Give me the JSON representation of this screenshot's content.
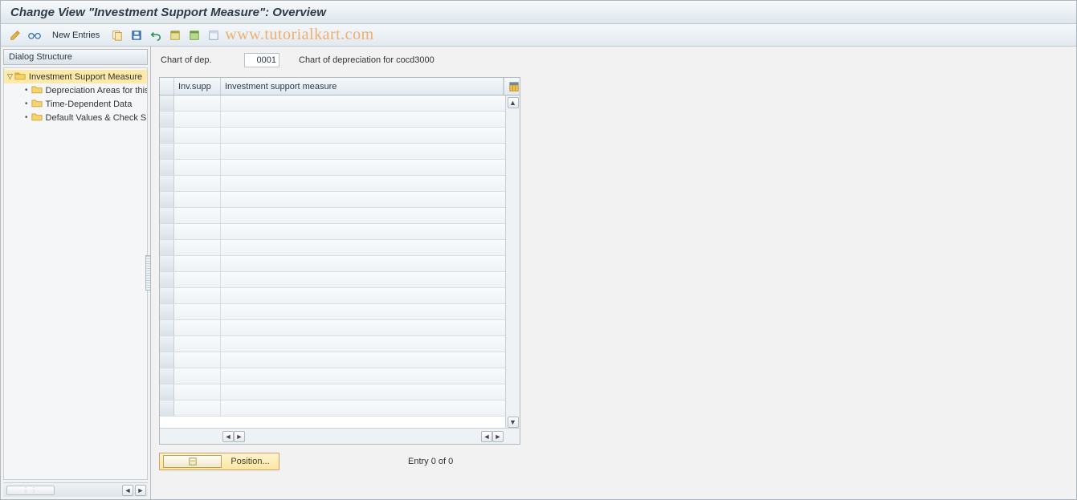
{
  "title": "Change View \"Investment Support Measure\": Overview",
  "toolbar": {
    "new_entries_label": "New Entries"
  },
  "watermark": "www.tutorialkart.com",
  "tree": {
    "header": "Dialog Structure",
    "items": [
      {
        "label": "Investment Support Measure",
        "selected": true,
        "level": 0,
        "open": true
      },
      {
        "label": "Depreciation Areas for this Measure",
        "selected": false,
        "level": 1
      },
      {
        "label": "Time-Dependent Data",
        "selected": false,
        "level": 1
      },
      {
        "label": "Default Values & Check Specifications",
        "selected": false,
        "level": 1
      }
    ]
  },
  "header": {
    "label": "Chart of dep.",
    "code": "0001",
    "desc": "Chart of depreciation for cocd3000"
  },
  "grid": {
    "col1": "Inv.supp",
    "col2": "Investment support measure",
    "empty_rows": 20
  },
  "footer": {
    "position_label": "Position...",
    "entry_status": "Entry 0 of 0"
  },
  "icons": {
    "edit": "edit-icon",
    "glasses": "display-icon",
    "copy": "copy-icon",
    "save": "save-icon",
    "undo": "undo-icon",
    "select_all": "select-all-icon",
    "select_block": "select-block-icon",
    "deselect": "deselect-icon",
    "config": "table-settings-icon"
  }
}
